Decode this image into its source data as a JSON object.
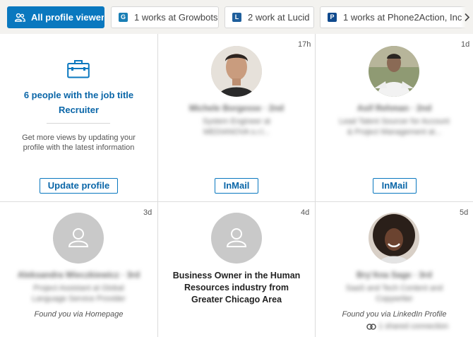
{
  "filters": [
    {
      "label": "All profile viewers",
      "icon": "people-icon",
      "active": true
    },
    {
      "label": "1 works at Growbots",
      "icon": "growbots-logo-icon",
      "active": false
    },
    {
      "label": "2 work at Lucid",
      "icon": "lucid-logo-icon",
      "active": false
    },
    {
      "label": "1 works at Phone2Action, Inc",
      "icon": "phone2action-logo-icon",
      "active": false
    }
  ],
  "promo": {
    "title": "6 people with the job title",
    "title_role": "Recruiter",
    "body_line1": "Get more views by updating your",
    "body_line2": "profile with the latest information",
    "button": "Update profile",
    "icon": "briefcase-icon"
  },
  "viewers": [
    {
      "time": "17h",
      "name": "Michele Borgesse · 2nd",
      "headline_l1": "System Engineer at",
      "headline_l2": "MEDIANOVA s.r.l...",
      "button": "InMail",
      "avatar": "photo-male-1"
    },
    {
      "time": "1d",
      "name": "Asif Rehman · 2nd",
      "headline_l1": "Lead Talent Sourcer for Account",
      "headline_l2": "& Project Management at...",
      "button": "InMail",
      "avatar": "photo-male-2"
    },
    {
      "time": "3d",
      "name": "Aleksandra Wieczkiewicz · 3rd",
      "headline_l1": "Project Assistant at Global",
      "headline_l2": "Language Service Provider",
      "found": "Found you via Homepage",
      "avatar": "placeholder"
    },
    {
      "time": "4d",
      "anonymous_l1": "Business Owner in the Human",
      "anonymous_l2": "Resources industry from",
      "anonymous_l3": "Greater Chicago Area",
      "avatar": "placeholder"
    },
    {
      "time": "5d",
      "name": "Bry'Ana Sage · 3rd",
      "headline_l1": "SaaS and Tech Content and",
      "headline_l2": "Copywriter",
      "found": "Found you via LinkedIn Profile",
      "shared": "1 shared connection",
      "avatar": "photo-female-1"
    }
  ],
  "colors": {
    "accent": "#0a78bf",
    "divider": "#dcdcdc"
  }
}
